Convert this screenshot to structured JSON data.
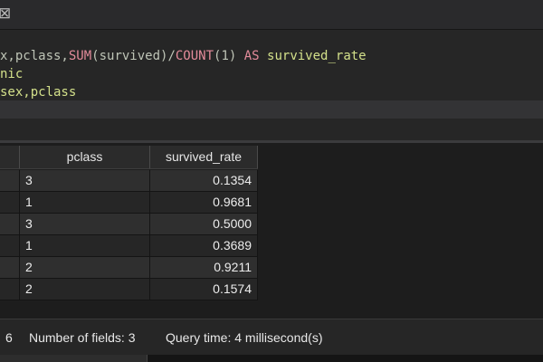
{
  "titlebar": {
    "close_glyph": "⊠"
  },
  "editor": {
    "lines": [
      [
        {
          "t": "x,pclass,",
          "c": "tok-pl"
        },
        {
          "t": "SUM",
          "c": "tok-fn"
        },
        {
          "t": "(survived)/",
          "c": "tok-pl"
        },
        {
          "t": "COUNT",
          "c": "tok-fn"
        },
        {
          "t": "(1) ",
          "c": "tok-pl"
        },
        {
          "t": "AS",
          "c": "tok-kw"
        },
        {
          "t": " survived_rate",
          "c": "tok-str"
        }
      ],
      [
        {
          "t": "nic",
          "c": "tok-str"
        }
      ],
      [
        {
          "t": "sex,pclass",
          "c": "tok-str"
        }
      ]
    ]
  },
  "grid": {
    "columns": [
      "pclass",
      "survived_rate"
    ],
    "rows": [
      {
        "pclass": "3",
        "survived_rate": "0.1354"
      },
      {
        "pclass": "1",
        "survived_rate": "0.9681"
      },
      {
        "pclass": "3",
        "survived_rate": "0.5000"
      },
      {
        "pclass": "1",
        "survived_rate": "0.3689"
      },
      {
        "pclass": "2",
        "survived_rate": "0.9211"
      },
      {
        "pclass": "2",
        "survived_rate": "0.1574"
      }
    ],
    "row_colors": [
      "#2f2f2f",
      "#262626"
    ]
  },
  "status": {
    "rows_count": "6",
    "fields": "Number of fields:  3",
    "query_time": "Query time:  4 millisecond(s)"
  }
}
